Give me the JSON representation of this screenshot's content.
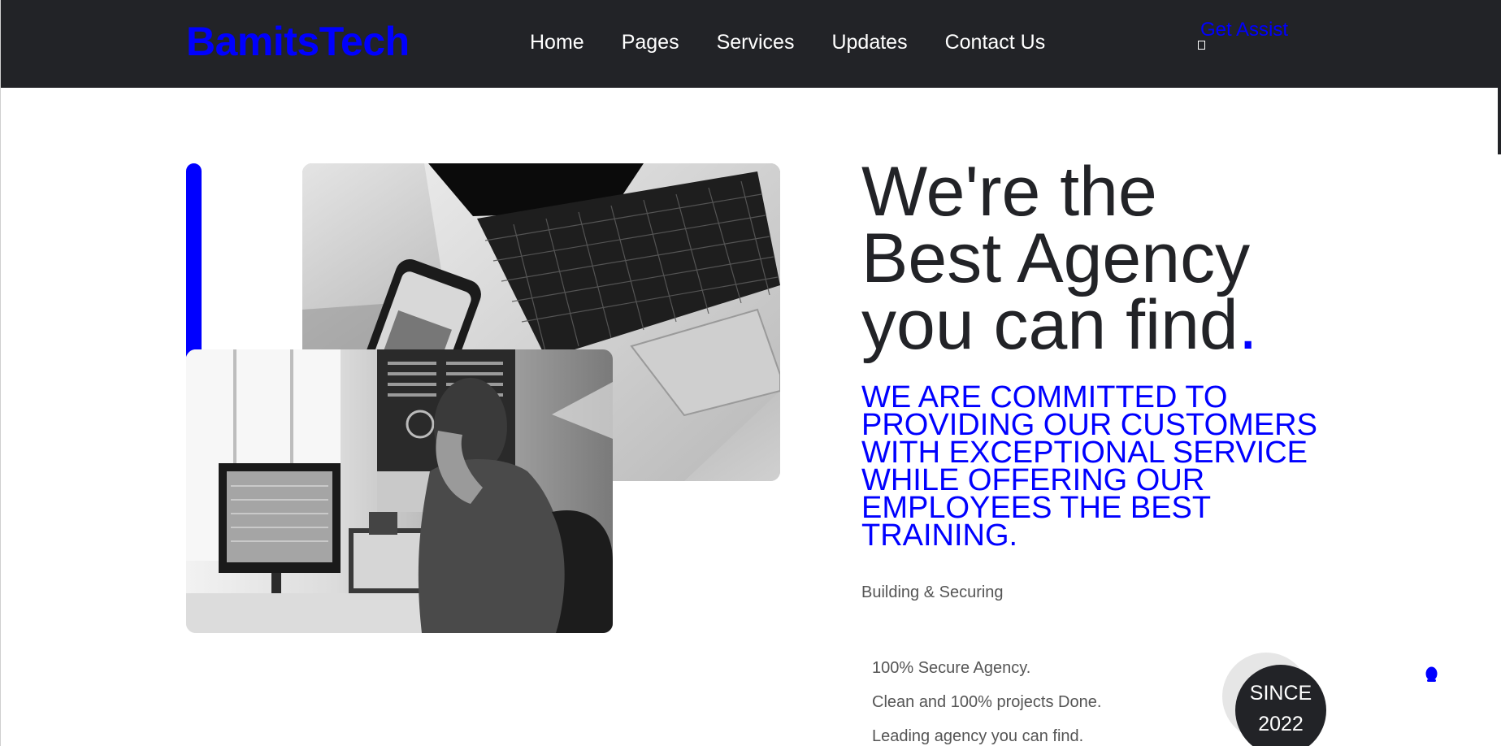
{
  "header": {
    "logo": "BamitsTech",
    "nav": [
      "Home",
      "Pages",
      "Services",
      "Updates",
      "Contact Us"
    ],
    "cta": "Get Assist"
  },
  "hero": {
    "headline_line1": "We're the",
    "headline_line2": "Best Agency",
    "headline_line3": "you can find",
    "headline_dot": ".",
    "mission": "WE ARE COMMITTED TO PROVIDING OUR CUSTOMERS WITH EXCEPTIONAL SERVICE WHILE OFFERING OUR EMPLOYEES THE BEST TRAINING.",
    "tagline": "Building & Securing",
    "features": [
      "100% Secure Agency.",
      "Clean and 100% projects Done.",
      "Leading agency you can find."
    ],
    "since_label": "SINCE",
    "since_year": "2022"
  },
  "images": {
    "top": "laptop-and-phone-photo",
    "bottom": "man-at-computer-photo"
  },
  "colors": {
    "accent": "#0000ff",
    "dark": "#222327",
    "muted_text": "#555555"
  }
}
